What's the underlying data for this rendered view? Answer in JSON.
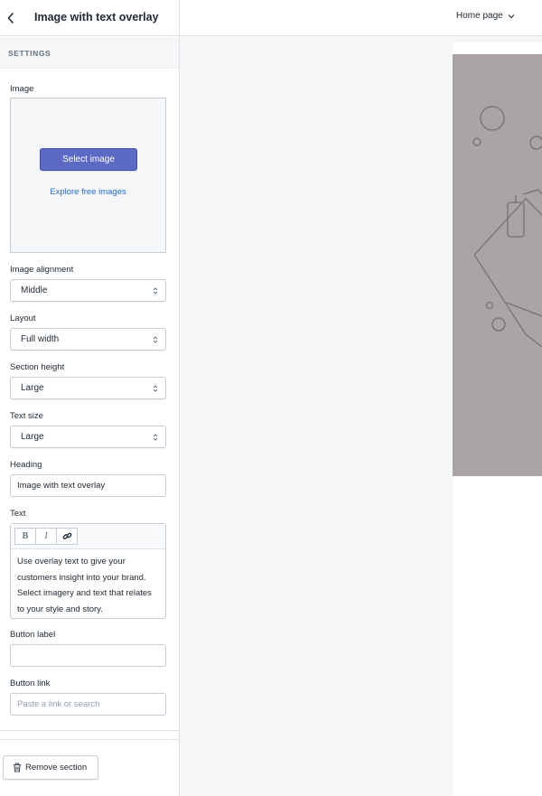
{
  "sidebar": {
    "title": "Image with text overlay",
    "settings_heading": "SETTINGS",
    "image": {
      "label": "Image",
      "select_button": "Select image",
      "explore_link": "Explore free images"
    },
    "image_alignment": {
      "label": "Image alignment",
      "value": "Middle"
    },
    "layout": {
      "label": "Layout",
      "value": "Full width"
    },
    "section_height": {
      "label": "Section height",
      "value": "Large"
    },
    "text_size": {
      "label": "Text size",
      "value": "Large"
    },
    "heading": {
      "label": "Heading",
      "value": "Image with text overlay"
    },
    "text": {
      "label": "Text",
      "toolbar": {
        "bold": "B",
        "italic": "I"
      },
      "lines": [
        "Use overlay text to give your",
        "customers insight into your brand.",
        "Select imagery and text that relates",
        "to your style and story."
      ]
    },
    "button_label": {
      "label": "Button label",
      "value": ""
    },
    "button_link": {
      "label": "Button link",
      "placeholder": "Paste a link or search"
    },
    "remove_button": "Remove section"
  },
  "topbar": {
    "page_selector": "Home page"
  },
  "colors": {
    "accent": "#5c6ac4",
    "link": "#2c6ecb",
    "preview_placeholder": "#aaa4a4",
    "canvas": "#f4f6f8"
  },
  "icons": {
    "back": "chevron-left-icon",
    "page_selector": "chevron-down-icon",
    "select_caret": "up-down-caret-icon",
    "link": "link-icon",
    "remove": "trash-icon"
  }
}
